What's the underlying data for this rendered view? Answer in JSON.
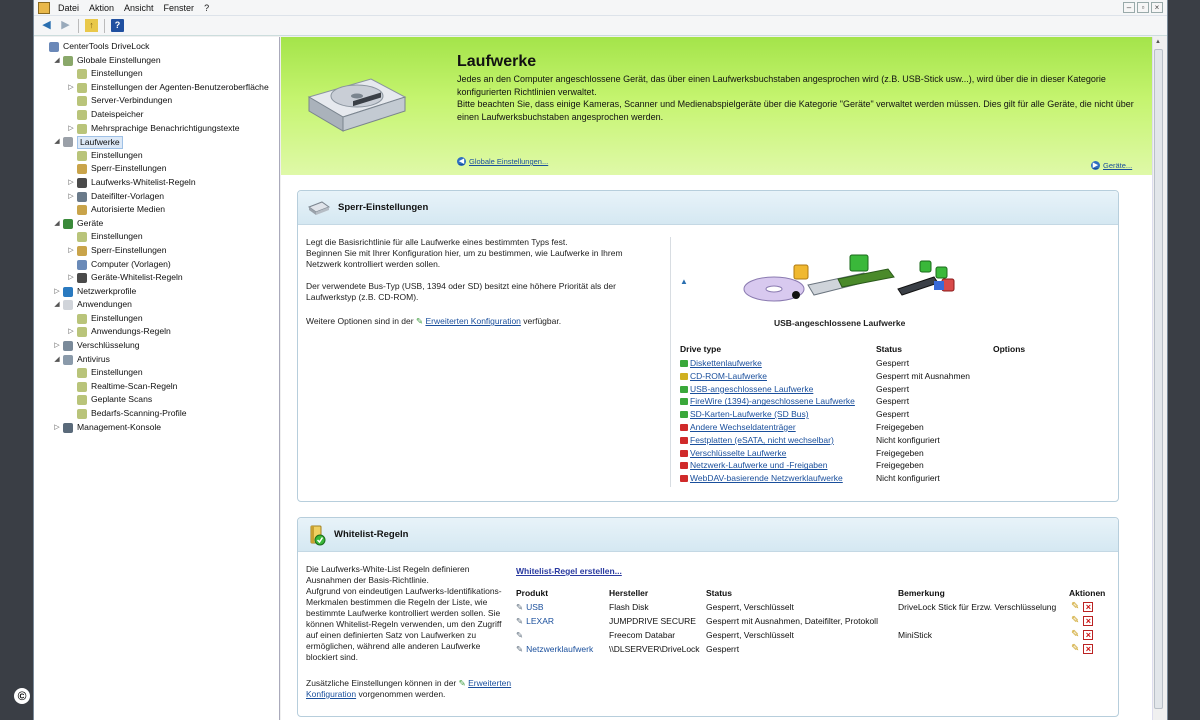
{
  "menu": [
    "Datei",
    "Aktion",
    "Ansicht",
    "Fenster",
    "?"
  ],
  "tree": [
    {
      "label": "CenterTools DriveLock",
      "depth": 0,
      "exp": "",
      "color": "#6a88b8"
    },
    {
      "label": "Globale Einstellungen",
      "depth": 1,
      "exp": "◢",
      "color": "#8aa86a"
    },
    {
      "label": "Einstellungen",
      "depth": 2,
      "exp": "",
      "color": "#b9c47a"
    },
    {
      "label": "Einstellungen der Agenten-Benutzeroberfläche",
      "depth": 2,
      "exp": "▷",
      "color": "#b9c47a"
    },
    {
      "label": "Server-Verbindungen",
      "depth": 2,
      "exp": "",
      "color": "#b9c47a"
    },
    {
      "label": "Dateispeicher",
      "depth": 2,
      "exp": "",
      "color": "#b9c47a"
    },
    {
      "label": "Mehrsprachige Benachrichtigungstexte",
      "depth": 2,
      "exp": "▷",
      "color": "#b9c47a"
    },
    {
      "label": "Laufwerke",
      "depth": 1,
      "exp": "◢",
      "color": "#9aa0a8",
      "selected": true
    },
    {
      "label": "Einstellungen",
      "depth": 2,
      "exp": "",
      "color": "#b9c47a"
    },
    {
      "label": "Sperr-Einstellungen",
      "depth": 2,
      "exp": "",
      "color": "#c9a44a"
    },
    {
      "label": "Laufwerks-Whitelist-Regeln",
      "depth": 2,
      "exp": "▷",
      "color": "#4a4a4a"
    },
    {
      "label": "Dateifilter-Vorlagen",
      "depth": 2,
      "exp": "▷",
      "color": "#6a7a8a"
    },
    {
      "label": "Autorisierte Medien",
      "depth": 2,
      "exp": "",
      "color": "#c9a44a"
    },
    {
      "label": "Geräte",
      "depth": 1,
      "exp": "◢",
      "color": "#3a8a3a"
    },
    {
      "label": "Einstellungen",
      "depth": 2,
      "exp": "",
      "color": "#b9c47a"
    },
    {
      "label": "Sperr-Einstellungen",
      "depth": 2,
      "exp": "▷",
      "color": "#c9a44a"
    },
    {
      "label": "Computer (Vorlagen)",
      "depth": 2,
      "exp": "",
      "color": "#6a8ab8"
    },
    {
      "label": "Geräte-Whitelist-Regeln",
      "depth": 2,
      "exp": "▷",
      "color": "#4a4a4a"
    },
    {
      "label": "Netzwerkprofile",
      "depth": 1,
      "exp": "▷",
      "color": "#2a7ac0"
    },
    {
      "label": "Anwendungen",
      "depth": 1,
      "exp": "◢",
      "color": "#d0d4da"
    },
    {
      "label": "Einstellungen",
      "depth": 2,
      "exp": "",
      "color": "#b9c47a"
    },
    {
      "label": "Anwendungs-Regeln",
      "depth": 2,
      "exp": "▷",
      "color": "#b9c47a"
    },
    {
      "label": "Verschlüsselung",
      "depth": 1,
      "exp": "▷",
      "color": "#7a8a9a"
    },
    {
      "label": "Antivirus",
      "depth": 1,
      "exp": "◢",
      "color": "#8a9aaa"
    },
    {
      "label": "Einstellungen",
      "depth": 2,
      "exp": "",
      "color": "#b9c47a"
    },
    {
      "label": "Realtime-Scan-Regeln",
      "depth": 2,
      "exp": "",
      "color": "#b9c47a"
    },
    {
      "label": "Geplante Scans",
      "depth": 2,
      "exp": "",
      "color": "#b9c47a"
    },
    {
      "label": "Bedarfs-Scanning-Profile",
      "depth": 2,
      "exp": "",
      "color": "#b9c47a"
    },
    {
      "label": "Management-Konsole",
      "depth": 1,
      "exp": "▷",
      "color": "#5a6a7a"
    }
  ],
  "hero": {
    "title": "Laufwerke",
    "p1": "Jedes an den Computer angeschlossene Gerät, das über einen Laufwerksbuchstaben angesprochen wird (z.B. USB-Stick usw...), wird über die in dieser Kategorie konfigurierten Richtlinien verwaltet.",
    "p2": "Bitte beachten Sie, dass einige Kameras, Scanner und Medienabspielgeräte über die Kategorie \"Geräte\" verwaltet werden müssen. Dies gilt für alle Geräte, die nicht über einen Laufwerksbuchstaben angesprochen werden.",
    "back_link": "Globale Einstellungen...",
    "next_link": "Geräte..."
  },
  "sperr": {
    "title": "Sperr-Einstellungen",
    "text1": "Legt die Basisrichtlinie für alle Laufwerke eines bestimmten Typs fest.",
    "text2": "Beginnen Sie mit Ihrer Konfiguration hier, um zu bestimmen, wie Laufwerke in Ihrem Netzwerk kontrolliert werden sollen.",
    "text3": "Der verwendete Bus-Typ (USB, 1394 oder SD) besitzt eine höhere Priorität als der Laufwerkstyp (z.B. CD-ROM).",
    "text4_pre": "Weitere Optionen sind in der",
    "text4_link": "Erweiterten Konfiguration",
    "text4_post": "verfügbar.",
    "image_caption": "USB-angeschlossene Laufwerke",
    "headers": {
      "type": "Drive type",
      "status": "Status",
      "options": "Options"
    },
    "drives": [
      {
        "name": "Diskettenlaufwerke",
        "status": "Gesperrt",
        "color": "#3aa83a"
      },
      {
        "name": "CD-ROM-Laufwerke",
        "status": "Gesperrt mit Ausnahmen",
        "color": "#d0b020"
      },
      {
        "name": "USB-angeschlossene Laufwerke",
        "status": "Gesperrt",
        "color": "#3aa83a"
      },
      {
        "name": "FireWire (1394)-angeschlossene Laufwerke",
        "status": "Gesperrt",
        "color": "#3aa83a"
      },
      {
        "name": "SD-Karten-Laufwerke (SD Bus)",
        "status": "Gesperrt",
        "color": "#3aa83a"
      },
      {
        "name": "Andere Wechseldatenträger",
        "status": "Freigegeben",
        "color": "#d02a2a"
      },
      {
        "name": "Festplatten (eSATA, nicht wechselbar)",
        "status": "Nicht konfiguriert",
        "color": "#d02a2a"
      },
      {
        "name": "Verschlüsselte Laufwerke",
        "status": "Freigegeben",
        "color": "#d02a2a"
      },
      {
        "name": "Netzwerk-Laufwerke und -Freigaben",
        "status": "Freigegeben",
        "color": "#d02a2a"
      },
      {
        "name": "WebDAV-basierende Netzwerklaufwerke",
        "status": "Nicht konfiguriert",
        "color": "#d02a2a"
      }
    ]
  },
  "whitelist": {
    "title": "Whitelist-Regeln",
    "text1": "Die Laufwerks-White-List Regeln definieren Ausnahmen der Basis-Richtlinie.",
    "text2": "Aufgrund von eindeutigen Laufwerks-Identifikations-Merkmalen bestimmen die Regeln der Liste, wie bestimmte Laufwerke kontrolliert werden sollen. Sie können Whitelist-Regeln verwenden, um den Zugriff auf einen definierten Satz von Laufwerken zu ermöglichen, während alle anderen Laufwerke blockiert sind.",
    "text3_pre": "Zusätzliche Einstellungen können in der",
    "text3_link": "Erweiterten Konfiguration",
    "text3_post": "vorgenommen werden.",
    "create_link": "Whitelist-Regel erstellen...",
    "headers": {
      "product": "Produkt",
      "vendor": "Hersteller",
      "status": "Status",
      "remark": "Bemerkung",
      "actions": "Aktionen"
    },
    "rows": [
      {
        "product": "USB",
        "vendor": "Flash Disk",
        "status": "Gesperrt, Verschlüsselt",
        "remark": "DriveLock Stick für Erzw. Verschlüsselung"
      },
      {
        "product": "LEXAR",
        "vendor": "JUMPDRIVE SECURE",
        "status": "Gesperrt mit Ausnahmen, Dateifilter, Protokoll",
        "remark": ""
      },
      {
        "product": "",
        "vendor": "Freecom Databar",
        "status": "Gesperrt, Verschlüsselt",
        "remark": "MiniStick"
      },
      {
        "product": "Netzwerklaufwerk",
        "vendor": "\\\\DLSERVER\\DriveLock",
        "status": "Gesperrt",
        "remark": ""
      }
    ]
  },
  "copyright": "©"
}
